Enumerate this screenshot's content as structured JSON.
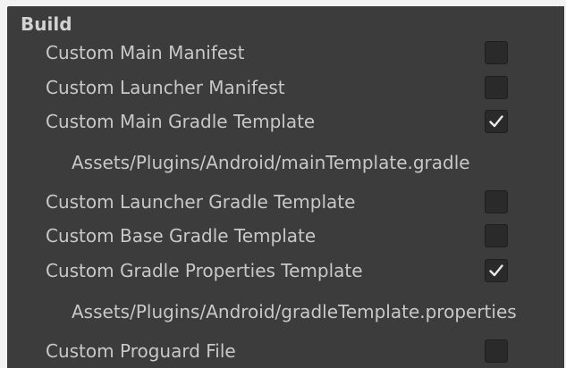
{
  "section": {
    "title": "Build"
  },
  "options": [
    {
      "label": "Custom Main Manifest",
      "checked": false
    },
    {
      "label": "Custom Launcher Manifest",
      "checked": false
    },
    {
      "label": "Custom Main Gradle Template",
      "checked": true
    },
    {
      "label": "Custom Launcher Gradle Template",
      "checked": false
    },
    {
      "label": "Custom Base Gradle Template",
      "checked": false
    },
    {
      "label": "Custom Gradle Properties Template",
      "checked": true
    },
    {
      "label": "Custom Proguard File",
      "checked": false
    }
  ],
  "paths": {
    "main_gradle_template": "Assets/Plugins/Android/mainTemplate.gradle",
    "gradle_properties_template": "Assets/Plugins/Android/gradleTemplate.properties"
  },
  "icons": {
    "checkmark": "checkmark-icon"
  },
  "colors": {
    "panel_background": "#3c3c3c",
    "text": "#c8c8c8",
    "checkbox_background": "#2a2a2a"
  }
}
